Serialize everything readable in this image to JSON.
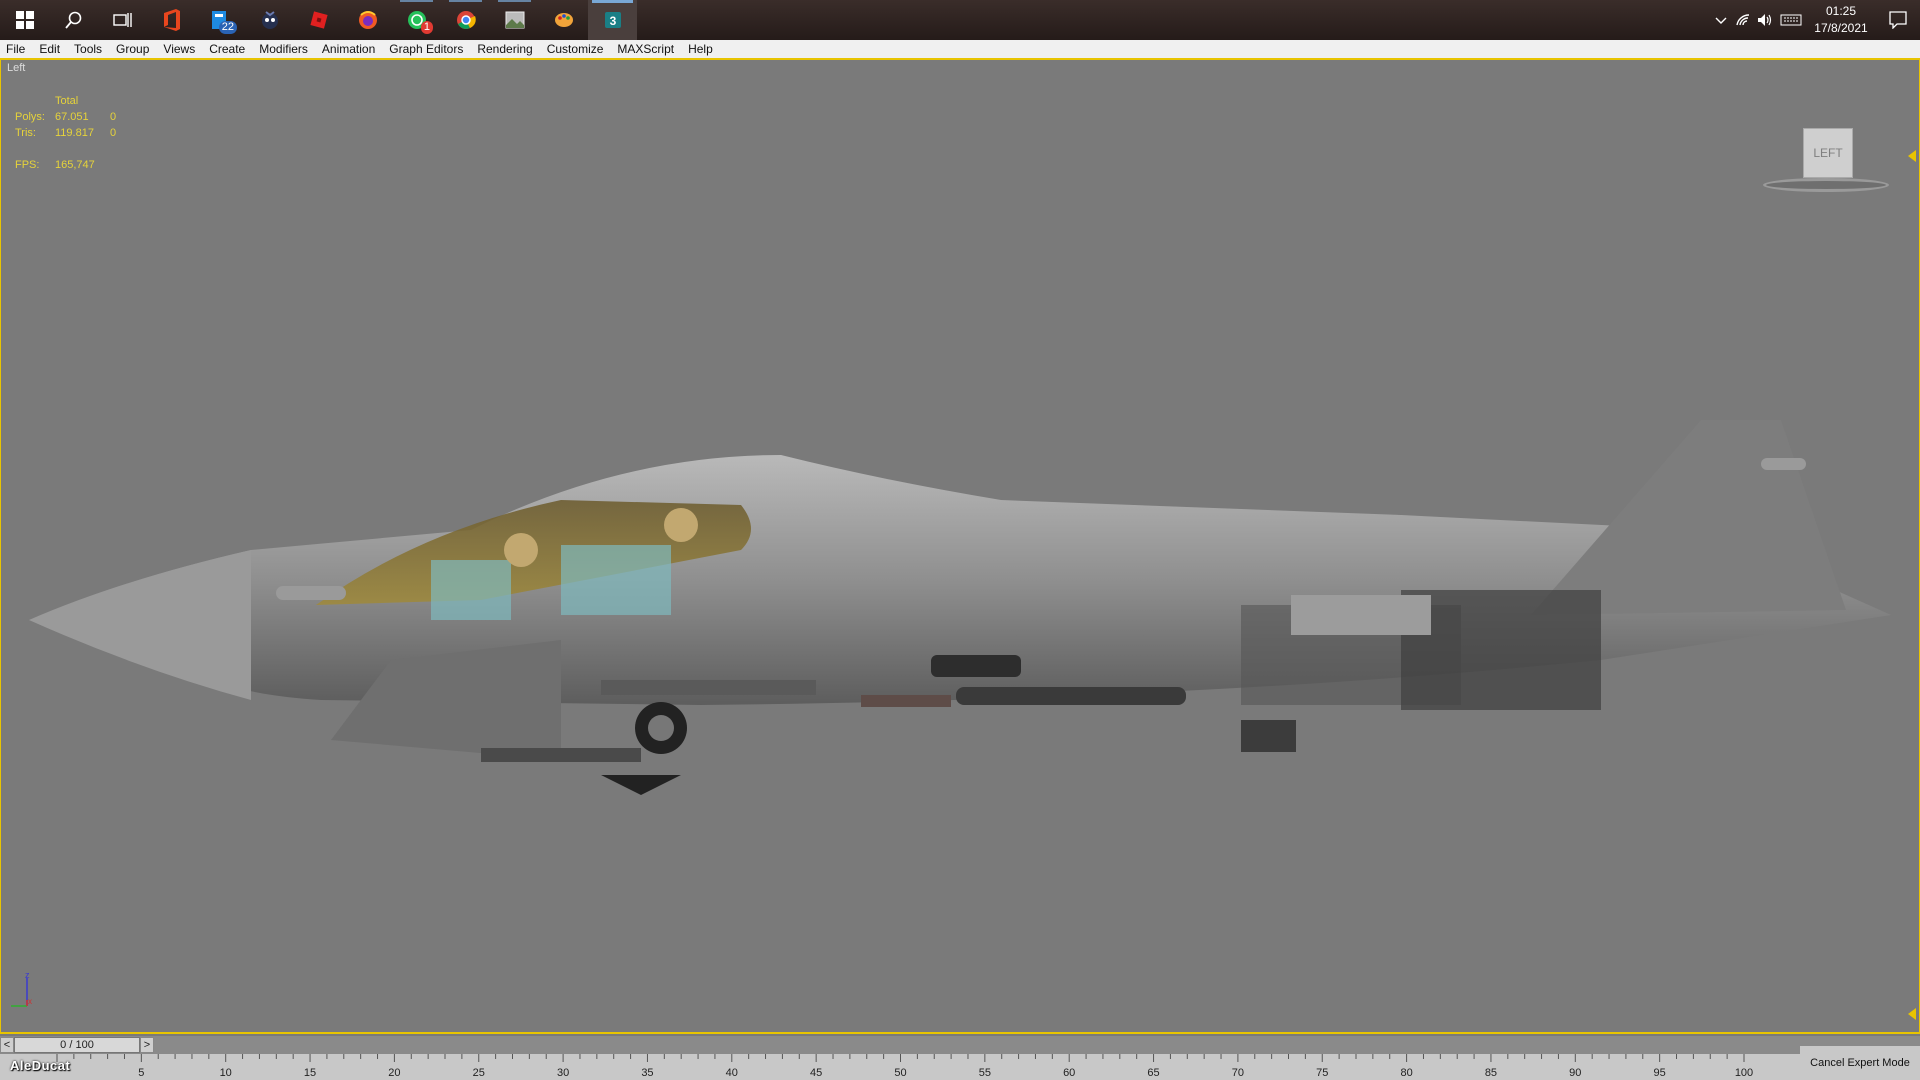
{
  "taskbar": {
    "apps": [
      {
        "name": "start-icon",
        "badge": ""
      },
      {
        "name": "search-icon",
        "badge": ""
      },
      {
        "name": "task-view-icon",
        "badge": ""
      },
      {
        "name": "office-icon",
        "badge": ""
      },
      {
        "name": "mail-icon",
        "badge": "22"
      },
      {
        "name": "game-controller-icon",
        "badge": ""
      },
      {
        "name": "roblox-icon",
        "badge": ""
      },
      {
        "name": "firefox-icon",
        "badge": ""
      },
      {
        "name": "whatsapp-icon",
        "badge": "1"
      },
      {
        "name": "chrome-icon",
        "badge": ""
      },
      {
        "name": "photos-icon",
        "badge": ""
      },
      {
        "name": "paint-icon",
        "badge": ""
      },
      {
        "name": "3dsmax-icon",
        "badge": ""
      }
    ],
    "clock_time": "01:25",
    "clock_date": "17/8/2021"
  },
  "menubar": {
    "items": [
      "File",
      "Edit",
      "Tools",
      "Group",
      "Views",
      "Create",
      "Modifiers",
      "Animation",
      "Graph Editors",
      "Rendering",
      "Customize",
      "MAXScript",
      "Help"
    ]
  },
  "viewport": {
    "label": "Left",
    "stats": {
      "header": "Total",
      "polys_label": "Polys:",
      "polys_total": "67.051",
      "polys_sel": "0",
      "tris_label": "Tris:",
      "tris_total": "119.817",
      "tris_sel": "0",
      "fps_label": "FPS:",
      "fps_value": "165,747"
    },
    "viewcube_label": "LEFT",
    "axis_z": "z",
    "axis_x": "x"
  },
  "timeline": {
    "position": "0 / 100",
    "prev": "<",
    "next": ">",
    "ticks": [
      "5",
      "10",
      "15",
      "20",
      "25",
      "30",
      "35",
      "40",
      "45",
      "50",
      "55",
      "60",
      "65",
      "70",
      "75",
      "80",
      "85",
      "90",
      "95",
      "100"
    ]
  },
  "status": {
    "expert_mode": "Cancel Expert Mode",
    "watermark": "AleDucat"
  },
  "colors": {
    "accent": "#e8c400",
    "stats": "#e6d33a",
    "viewport_bg": "#7a7a7a"
  }
}
